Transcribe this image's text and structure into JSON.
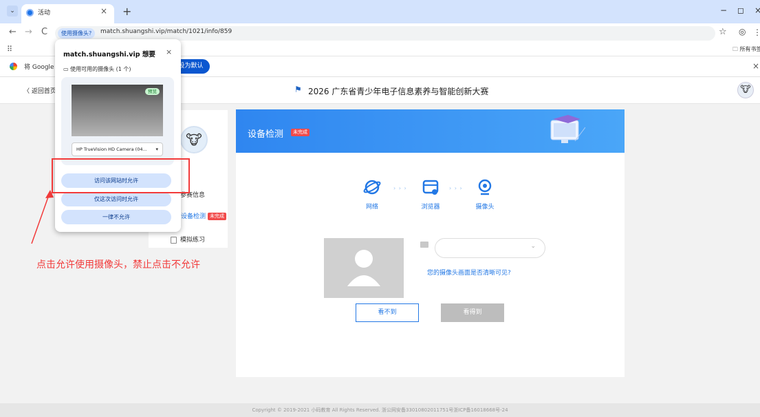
{
  "browser": {
    "tab_title": "活动",
    "tab_close": "×",
    "new_tab": "+",
    "dropdown": "⌄",
    "win_min": "−",
    "win_max": "◻",
    "win_close": "×",
    "back": "←",
    "forward": "→",
    "reload": "C",
    "camera_chip": "使用摄像头?",
    "url": "match.shuangshi.vip/match/1021/info/859",
    "star": "☆",
    "profile": "◎",
    "more": "⋮",
    "apps": "⠿",
    "all_bookmarks": "所有书签",
    "infobar_text": "将 Google Chrome 设为默认浏览器",
    "infobar_button": "设为默认",
    "infobar_close": "×"
  },
  "header": {
    "back_label": "〈 返回首页",
    "flag": "⚑",
    "title": "2026 广东省青少年电子信息素养与智能创新大赛"
  },
  "sidebar": {
    "items": [
      {
        "label": "参赛信息"
      },
      {
        "label": "设备检测",
        "badge": "未完成"
      },
      {
        "label": "模拟练习"
      }
    ]
  },
  "panel": {
    "title": "设备检测",
    "badge": "未完成",
    "steps": [
      {
        "label": "网络",
        "icon": "globe-icon"
      },
      {
        "label": "浏览器",
        "icon": "browser-icon"
      },
      {
        "label": "摄像头",
        "icon": "webcam-icon"
      }
    ],
    "arrow": "› › ›",
    "select_arrow": "⌄",
    "question": "您的摄像头画面是否清晰可见?",
    "btn_cannot": "看不到",
    "btn_can": "看得到"
  },
  "footer": {
    "text": "Copyright © 2019-2021 小码教育 All Rights Reserved. 浙公网安备33010802011751号浙ICP备16018668号-24"
  },
  "annotation": {
    "instruction": "点击允许使用摄像头，禁止点击不允许"
  },
  "popup": {
    "title": "match.shuangshi.vip 想要",
    "close": "×",
    "subtitle": "使用可用的摄像头 (1 个)",
    "preview_tag": "预览",
    "camera_name": "HP TrueVision HD Camera (04...",
    "camera_arrow": "▾",
    "btn_allow_always": "访问该网站时允许",
    "btn_allow_once": "仅这次访问时允许",
    "btn_deny": "一律不允许"
  },
  "colors": {
    "accent": "#2378e5",
    "warning": "#f23a3a",
    "chrome_tabbar": "#d3e3fd"
  }
}
